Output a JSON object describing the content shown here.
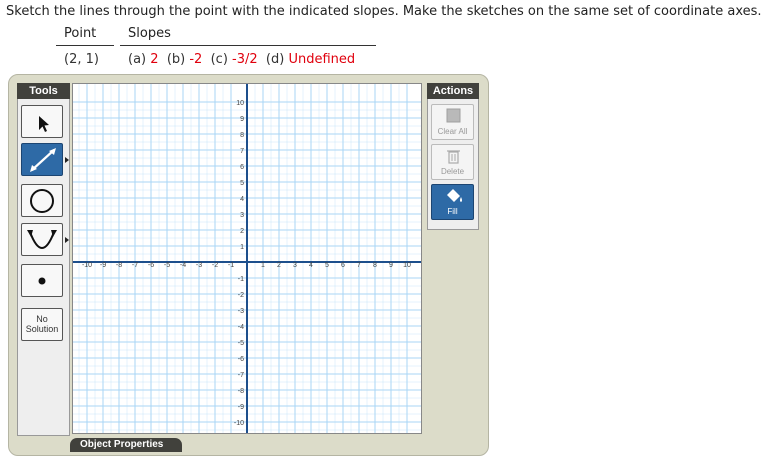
{
  "prompt": "Sketch the lines through the point with the indicated slopes. Make the sketches on the same set of coordinate axes.",
  "table": {
    "point_header": "Point",
    "slopes_header": "Slopes",
    "point_value": "(2, 1)",
    "slopes": [
      {
        "label": "(a)",
        "value": "2"
      },
      {
        "label": "(b)",
        "value": "-2"
      },
      {
        "label": "(c)",
        "value": "-3/2"
      },
      {
        "label": "(d)",
        "value": "Undefined"
      }
    ]
  },
  "tools": {
    "title": "Tools",
    "buttons": [
      {
        "name": "select-tool",
        "icon": "arrow-pointer-icon"
      },
      {
        "name": "line-tool",
        "icon": "line-icon",
        "active": true
      },
      {
        "name": "circle-tool",
        "icon": "circle-icon"
      },
      {
        "name": "parabola-tool",
        "icon": "parabola-icon"
      },
      {
        "name": "point-tool",
        "icon": "point-icon"
      },
      {
        "name": "no-solution-tool",
        "label": "No Solution"
      }
    ],
    "no_solution_label": "No Solution"
  },
  "actions": {
    "title": "Actions",
    "clear_all": "Clear All",
    "delete": "Delete",
    "fill": "Fill"
  },
  "graph": {
    "x_min": -10,
    "x_max": 10,
    "y_min": -10,
    "y_max": 10,
    "x_ticks": [
      -10,
      -9,
      -8,
      -7,
      -6,
      -5,
      -4,
      -3,
      -2,
      -1,
      1,
      2,
      3,
      4,
      5,
      6,
      7,
      8,
      9,
      10
    ],
    "y_ticks": [
      10,
      9,
      8,
      7,
      6,
      5,
      4,
      3,
      2,
      1,
      -1,
      -2,
      -3,
      -4,
      -5,
      -6,
      -7,
      -8,
      -9,
      -10
    ],
    "grid_color": "#a9d6f5",
    "axis_color": "#1d4f8c"
  },
  "object_properties": "Object Properties",
  "colors": {
    "accent": "#2e6aa6",
    "answer_red": "#e0000d",
    "panel_dark": "#41413c"
  }
}
